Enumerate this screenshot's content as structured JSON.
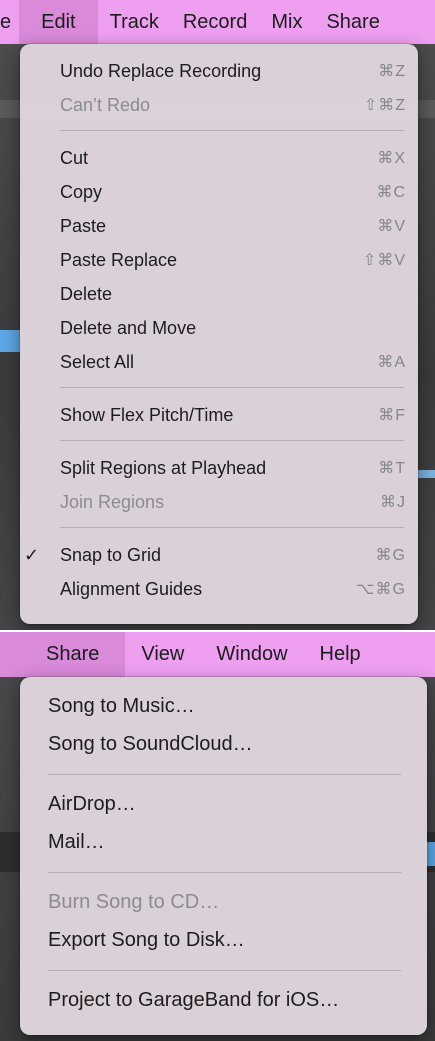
{
  "top": {
    "menubar": [
      {
        "label": "e"
      },
      {
        "label": "Edit",
        "active": true
      },
      {
        "label": "Track"
      },
      {
        "label": "Record"
      },
      {
        "label": "Mix"
      },
      {
        "label": "Share"
      }
    ],
    "edit_menu": {
      "items": [
        {
          "label": "Undo Replace Recording",
          "shortcut": "⌘Z",
          "disabled": false
        },
        {
          "label": "Can’t Redo",
          "shortcut": "⇧⌘Z",
          "disabled": true
        },
        {
          "label": "Cut",
          "shortcut": "⌘X",
          "disabled": false
        },
        {
          "label": "Copy",
          "shortcut": "⌘C",
          "disabled": false
        },
        {
          "label": "Paste",
          "shortcut": "⌘V",
          "disabled": false
        },
        {
          "label": "Paste Replace",
          "shortcut": "⇧⌘V",
          "disabled": false
        },
        {
          "label": "Delete",
          "shortcut": "",
          "disabled": false
        },
        {
          "label": "Delete and Move",
          "shortcut": "",
          "disabled": false
        },
        {
          "label": "Select All",
          "shortcut": "⌘A",
          "disabled": false
        },
        {
          "label": "Show Flex Pitch/Time",
          "shortcut": "⌘F",
          "disabled": false
        },
        {
          "label": "Split Regions at Playhead",
          "shortcut": "⌘T",
          "disabled": false
        },
        {
          "label": "Join Regions",
          "shortcut": "⌘J",
          "disabled": true
        },
        {
          "label": "Snap to Grid",
          "shortcut": "⌘G",
          "disabled": false,
          "checked": true,
          "check": "✓"
        },
        {
          "label": "Alignment Guides",
          "shortcut": "⌥⌘G",
          "disabled": false
        }
      ]
    }
  },
  "bottom": {
    "menubar": [
      {
        "label": "Share",
        "active": true
      },
      {
        "label": "View"
      },
      {
        "label": "Window"
      },
      {
        "label": "Help"
      }
    ],
    "share_menu": {
      "items": [
        {
          "label": "Song to Music…",
          "disabled": false
        },
        {
          "label": "Song to SoundCloud…",
          "disabled": false
        },
        {
          "label": "AirDrop…",
          "disabled": false
        },
        {
          "label": "Mail…",
          "disabled": false
        },
        {
          "label": "Burn Song to CD…",
          "disabled": true
        },
        {
          "label": "Export Song to Disk…",
          "disabled": false
        },
        {
          "label": "Project to GarageBand for iOS…",
          "disabled": false
        }
      ]
    }
  },
  "colors": {
    "menubar_bg": "#ee9ff0",
    "menubar_active": "#d98ad9",
    "menu_bg": "#ded6dc",
    "disabled_text": "#8c8c90"
  }
}
